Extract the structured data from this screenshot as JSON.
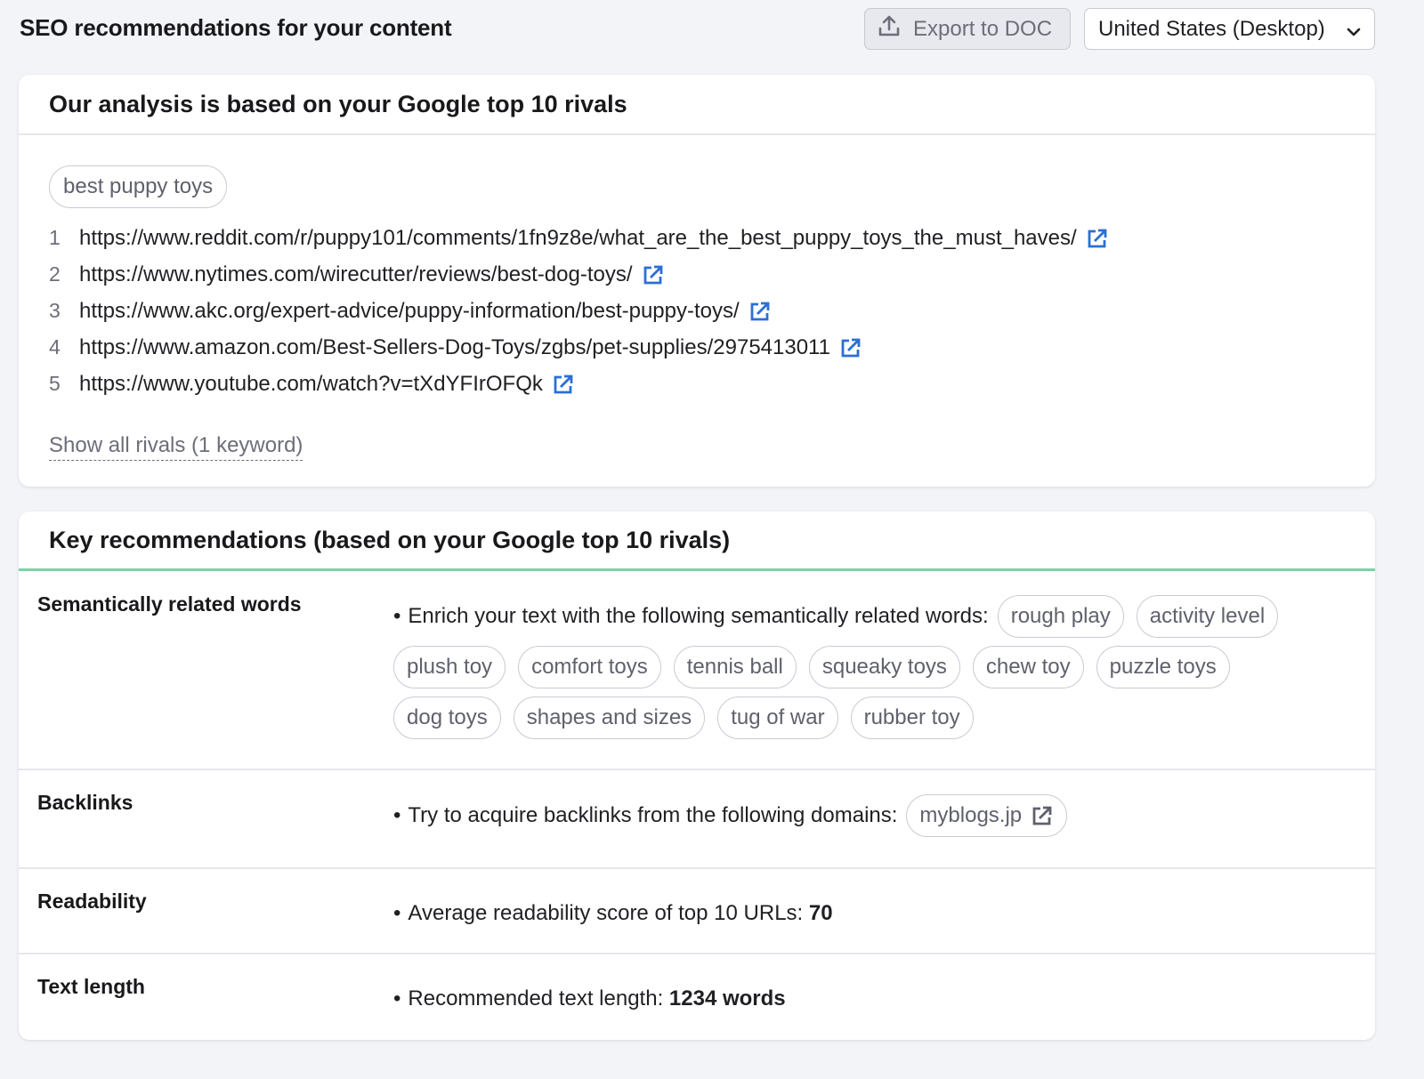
{
  "header": {
    "title": "SEO recommendations for your content",
    "export_label": "Export to DOC",
    "country_select": "United States (Desktop)"
  },
  "analysis_card": {
    "title": "Our analysis is based on your Google top 10 rivals",
    "keyword": "best puppy toys",
    "rivals": [
      {
        "rank": "1",
        "url": "https://www.reddit.com/r/puppy101/comments/1fn9z8e/what_are_the_best_puppy_toys_the_must_haves/"
      },
      {
        "rank": "2",
        "url": "https://www.nytimes.com/wirecutter/reviews/best-dog-toys/"
      },
      {
        "rank": "3",
        "url": "https://www.akc.org/expert-advice/puppy-information/best-puppy-toys/"
      },
      {
        "rank": "4",
        "url": "https://www.amazon.com/Best-Sellers-Dog-Toys/zgbs/pet-supplies/2975413011"
      },
      {
        "rank": "5",
        "url": "https://www.youtube.com/watch?v=tXdYFIrOFQk"
      }
    ],
    "show_all_label": "Show all rivals (1 keyword)"
  },
  "recommendations_card": {
    "title": "Key recommendations (based on your Google top 10 rivals)",
    "semantic": {
      "label": "Semantically related words",
      "bullet": "•",
      "text": "Enrich your text with the following semantically related words:",
      "words": [
        "rough play",
        "activity level",
        "plush toy",
        "comfort toys",
        "tennis ball",
        "squeaky toys",
        "chew toy",
        "puzzle toys",
        "dog toys",
        "shapes and sizes",
        "tug of war",
        "rubber toy"
      ]
    },
    "backlinks": {
      "label": "Backlinks",
      "bullet": "•",
      "text": "Try to acquire backlinks from the following domains:",
      "domains": [
        "myblogs.jp"
      ]
    },
    "readability": {
      "label": "Readability",
      "bullet": "•",
      "text": "Average readability score of top 10 URLs:",
      "value": "70"
    },
    "text_length": {
      "label": "Text length",
      "bullet": "•",
      "text": "Recommended text length:",
      "value": "1234 words"
    }
  },
  "colors": {
    "accent_green": "#7ad3a8",
    "link_icon_blue": "#2b6fd6",
    "background": "#f3f4f8"
  }
}
